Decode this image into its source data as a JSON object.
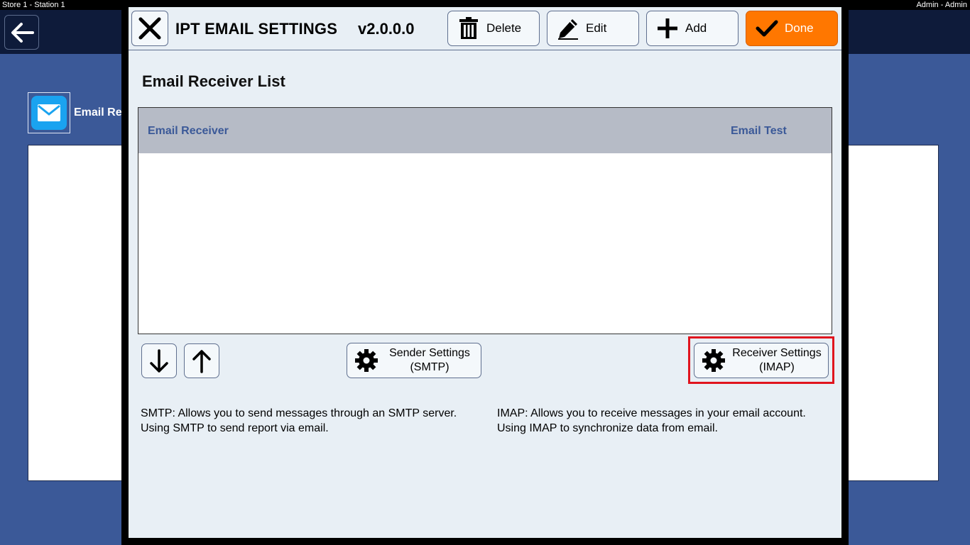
{
  "statusbar": {
    "left": "Store 1 - Station 1",
    "right": "Admin - Admin"
  },
  "background": {
    "label": "Email Re"
  },
  "modal": {
    "title": "IPT EMAIL SETTINGS",
    "version": "v2.0.0.0",
    "toolbar": {
      "delete_label": "Delete",
      "edit_label": "Edit",
      "add_label": "Add",
      "done_label": "Done"
    },
    "section_title": "Email Receiver List",
    "list": {
      "columns": [
        "Email Receiver",
        "Email Test"
      ],
      "rows": []
    },
    "sender_settings": {
      "line1": "Sender Settings",
      "line2": "(SMTP)"
    },
    "receiver_settings": {
      "line1": "Receiver Settings",
      "line2": "(IMAP)"
    },
    "smtp_description": "SMTP: Allows you to send messages through an SMTP server. Using SMTP to send report via email.",
    "imap_description": "IMAP: Allows you to receive messages in your email account. Using IMAP to synchronize data from email."
  },
  "colors": {
    "accent_done": "#ff7700",
    "header_blue": "#3b5998",
    "highlight_red": "#e0141e"
  }
}
